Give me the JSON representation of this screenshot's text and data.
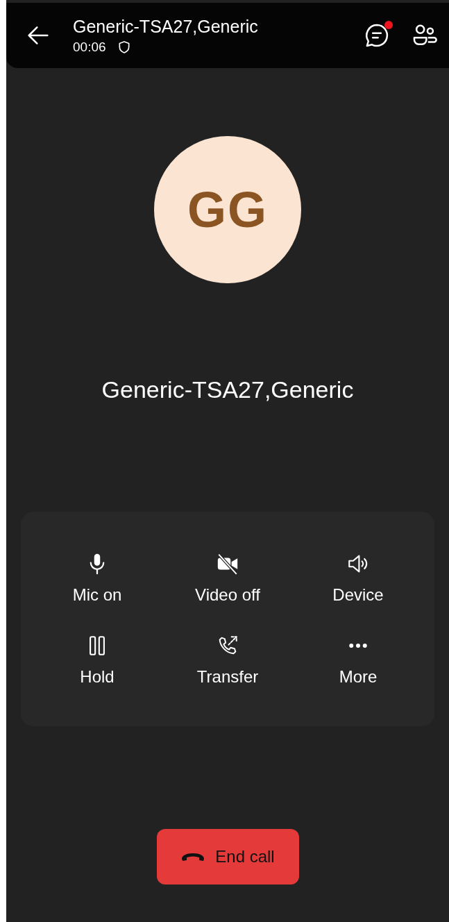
{
  "header": {
    "title": "Generic-TSA27,Generic",
    "timer": "00:06",
    "chat_unread": true
  },
  "avatar": {
    "initials": "GG"
  },
  "caller_name": "Generic-TSA27,Generic",
  "controls": [
    {
      "kind": "mic",
      "label": "Mic on"
    },
    {
      "kind": "video-off",
      "label": "Video off"
    },
    {
      "kind": "speaker",
      "label": "Device"
    },
    {
      "kind": "hold",
      "label": "Hold"
    },
    {
      "kind": "transfer",
      "label": "Transfer"
    },
    {
      "kind": "more",
      "label": "More"
    }
  ],
  "end_call": {
    "label": "End call"
  }
}
